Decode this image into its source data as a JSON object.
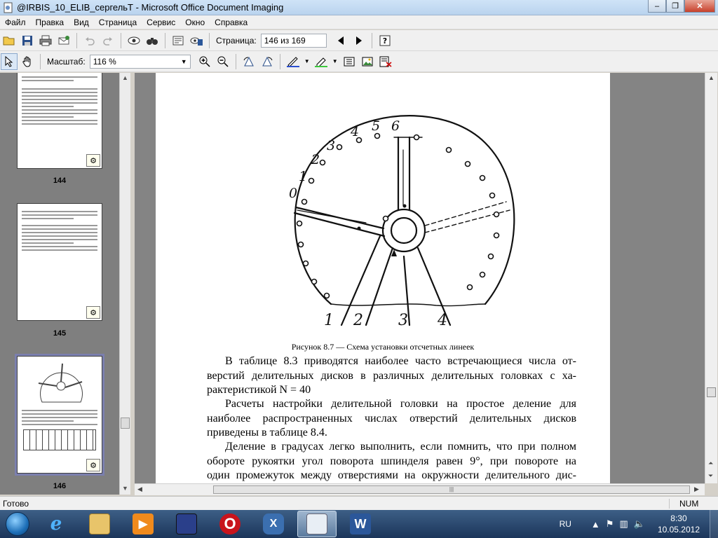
{
  "window": {
    "title": "@IRBIS_10_ELIB_сергельТ - Microsoft Office Document Imaging",
    "minimize": "–",
    "restore": "❐",
    "close": "✕"
  },
  "menu": [
    "Файл",
    "Правка",
    "Вид",
    "Страница",
    "Сервис",
    "Окно",
    "Справка"
  ],
  "toolbar1": {
    "page_label": "Страница:",
    "page_value": "146 из 169"
  },
  "toolbar2": {
    "zoom_label": "Масштаб:",
    "zoom_value": "116 %"
  },
  "thumbnails": [
    {
      "page": "144"
    },
    {
      "page": "145"
    },
    {
      "page": "146"
    }
  ],
  "document": {
    "figure_labels": {
      "top": [
        "0",
        "1",
        "2",
        "3",
        "4",
        "5",
        "6"
      ],
      "bottom": [
        "1",
        "2",
        "3",
        "4"
      ]
    },
    "caption": "Рисунок 8.7 — Схема установки отсчетных линеек",
    "para1": [
      "В таблице 8.3 приводятся наиболее часто встречающиеся числа от-",
      "верстий делительных дисков в различных делительных головках с ха-",
      "рактеристикой N = 40"
    ],
    "para2": [
      "Расчеты настройки делительной головки на простое деление для",
      "наиболее распространенных числах отверстий делительных дисков",
      "приведены в таблице 8.4."
    ],
    "para3": [
      "Деление в градусах легко выполнить, если помнить, что при полном",
      "обороте рукоятки угол поворота шпинделя равен 9°, при повороте на",
      "один промежуток между отверстиями на окружности делительного дис-"
    ]
  },
  "status": {
    "text": "Готово",
    "num": "NUM"
  },
  "taskbar": {
    "lang": "RU",
    "time": "8:30",
    "date": "10.05.2012"
  }
}
